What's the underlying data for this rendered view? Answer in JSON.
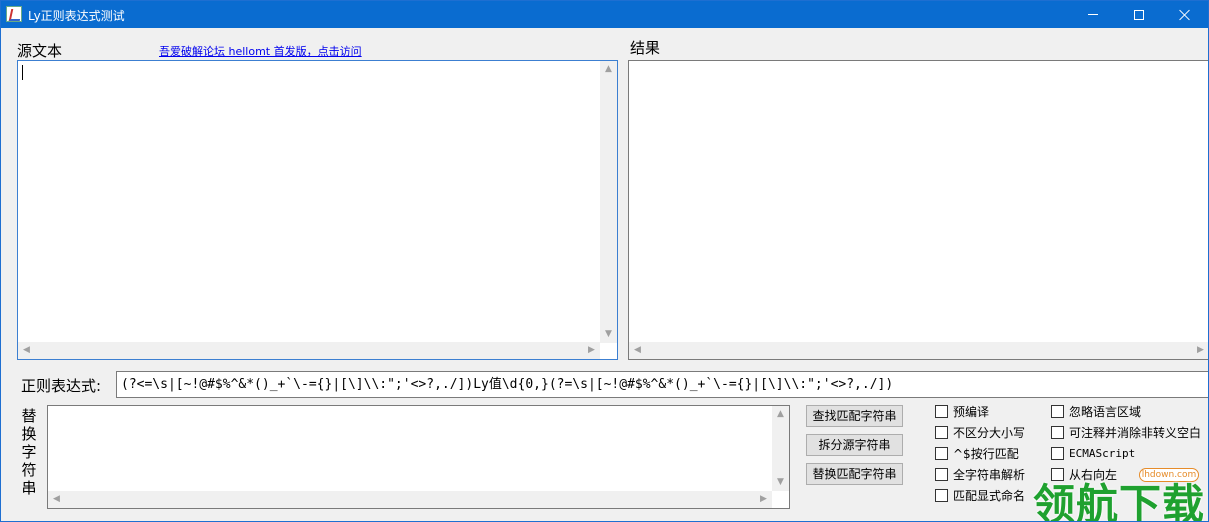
{
  "window": {
    "title": "Ly正则表达式测试",
    "icon": "app-icon",
    "controls": [
      "minimize-icon",
      "maximize-icon",
      "close-icon"
    ]
  },
  "labels": {
    "source": "源文本",
    "result": "结果",
    "regex": "正则表达式:",
    "replace": "替换字符串"
  },
  "link": {
    "text": "吾爱破解论坛 hellomt 首发版，点击访问"
  },
  "regex": {
    "value": "(?<=\\s|[~!@#$%^&*()_+`\\-={}|[\\]\\\\:\";'<>?,./])Ly值\\d{0,}(?=\\s|[~!@#$%^&*()_+`\\-={}|[\\]\\\\:\";'<>?,./])"
  },
  "buttons": {
    "find": "查找匹配字符串",
    "split": "拆分源字符串",
    "replace": "替换匹配字符串"
  },
  "options": {
    "left": [
      {
        "label": "预编译",
        "checked": false
      },
      {
        "label": "不区分大小写",
        "checked": false
      },
      {
        "label": "^$按行匹配",
        "checked": false
      },
      {
        "label": "全字符串解析",
        "checked": false
      },
      {
        "label": "匹配显式命名",
        "checked": false
      }
    ],
    "right": [
      {
        "label": "忽略语言区域",
        "checked": false
      },
      {
        "label": "可注释并消除非转义空白",
        "checked": false
      },
      {
        "label": "ECMAScript",
        "checked": false
      },
      {
        "label": "从右向左",
        "checked": false
      }
    ]
  },
  "watermark": {
    "site": "lhdown.com",
    "brand": "领航下载"
  },
  "colors": {
    "titlebar": "#0a6cd0",
    "link": "#0000ee",
    "watermark_green": "#1fa12f",
    "watermark_orange": "#e68c2a"
  }
}
